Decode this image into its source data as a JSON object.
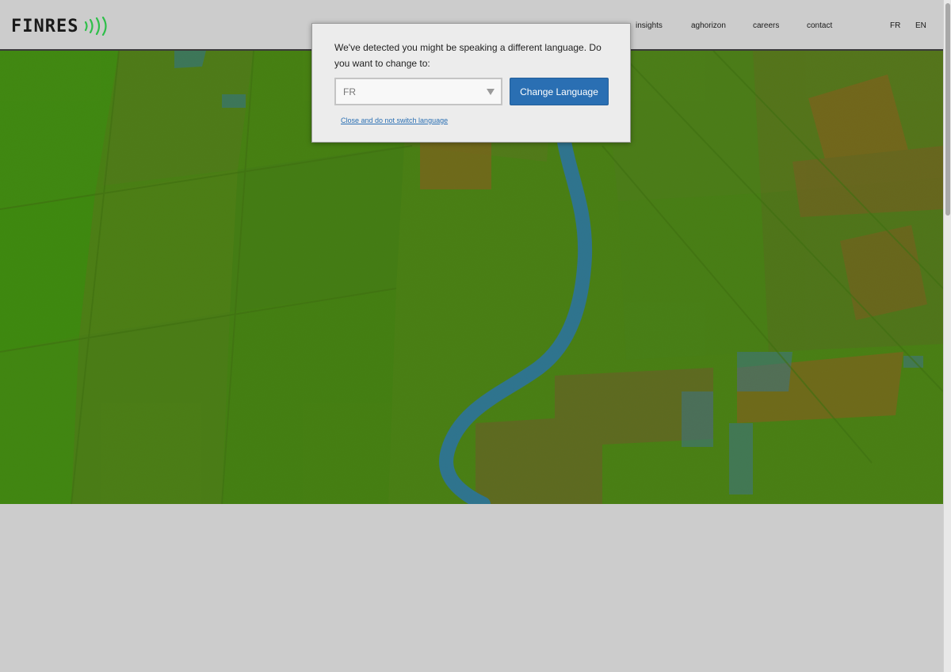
{
  "brand": {
    "logo_text": "FINRES",
    "logo_icon": "signal-waves-icon"
  },
  "nav": {
    "items": [
      {
        "label": "insights"
      },
      {
        "label": "aghorizon"
      },
      {
        "label": "careers"
      },
      {
        "label": "contact"
      }
    ],
    "lang_fr": "FR",
    "lang_en": "EN"
  },
  "modal": {
    "message": "We've detected you might be speaking a different language. Do you want to change to:",
    "select_value": "FR",
    "button_label": "Change Language",
    "close_link": "Close and do not switch language"
  },
  "colors": {
    "accent": "#2a6fb3",
    "logo_green": "#2fbf4a",
    "field_green": "#4a7d14",
    "river_blue": "#2a70a8",
    "soil_orange": "#8a5a1e",
    "page_gray": "#cccccc"
  }
}
